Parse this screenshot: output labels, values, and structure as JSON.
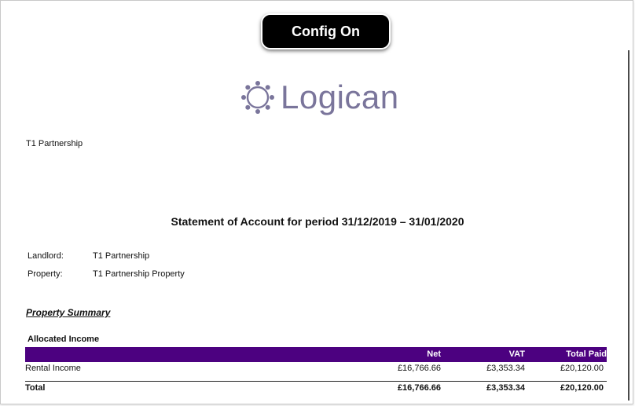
{
  "badge": {
    "label": "Config On"
  },
  "logo": {
    "text": "Logican",
    "icon": "gear-icon",
    "color": "#7a759b"
  },
  "addressee": "T1 Partnership",
  "statement_title": "Statement of Account for period 31/12/2019 – 31/01/2020",
  "details": [
    {
      "key": "Landlord:",
      "value": "T1 Partnership"
    },
    {
      "key": "Property:",
      "value": "T1 Partnership Property"
    }
  ],
  "section": {
    "title": "Property Summary",
    "subtitle": "Allocated Income"
  },
  "table": {
    "header_color": "#4c0180",
    "columns": [
      "",
      "Net",
      "VAT",
      "Total Paid"
    ],
    "rows": [
      {
        "label": "Rental Income",
        "net": "£16,766.66",
        "vat": "£3,353.34",
        "total": "£20,120.00"
      }
    ],
    "total": {
      "label": "Total",
      "net": "£16,766.66",
      "vat": "£3,353.34",
      "total": "£20,120.00"
    }
  }
}
